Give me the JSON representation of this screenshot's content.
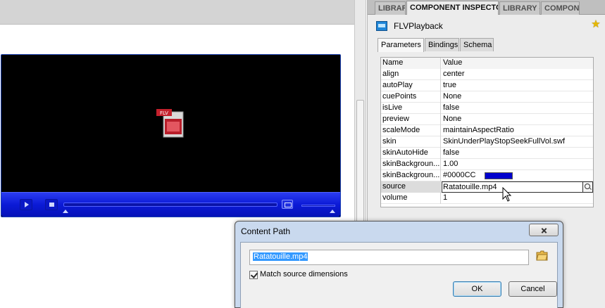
{
  "panel": {
    "tabs": [
      {
        "label": "LIBRARY"
      },
      {
        "label": "COMPONENT INSPECTOR"
      },
      {
        "label": "LIBRARY -"
      },
      {
        "label": "COMPONE"
      }
    ],
    "component_name": "FLVPlayback",
    "inner_tabs": [
      {
        "label": "Parameters"
      },
      {
        "label": "Bindings"
      },
      {
        "label": "Schema"
      }
    ],
    "grid": {
      "header": {
        "name": "Name",
        "value": "Value"
      },
      "rows": [
        {
          "name": "align",
          "value": "center"
        },
        {
          "name": "autoPlay",
          "value": "true"
        },
        {
          "name": "cuePoints",
          "value": "None"
        },
        {
          "name": "isLive",
          "value": "false"
        },
        {
          "name": "preview",
          "value": "None"
        },
        {
          "name": "scaleMode",
          "value": "maintainAspectRatio"
        },
        {
          "name": "skin",
          "value": "SkinUnderPlayStopSeekFullVol.swf"
        },
        {
          "name": "skinAutoHide",
          "value": "false"
        },
        {
          "name": "skinBackgroun...",
          "value": "1.00"
        },
        {
          "name": "skinBackgroun...",
          "value": "#0000CC",
          "color": "#0000CC"
        },
        {
          "name": "source",
          "value": "Ratatouille.mp4"
        },
        {
          "name": "volume",
          "value": "1"
        }
      ]
    }
  },
  "stage": {
    "flv_icon_label": "FLV",
    "skin_color": "#0000CC"
  },
  "dialog": {
    "title": "Content Path",
    "path_value": "Ratatouille.mp4",
    "checkbox_label": "Match source dimensions",
    "checkbox_checked": true,
    "ok_label": "OK",
    "cancel_label": "Cancel"
  }
}
